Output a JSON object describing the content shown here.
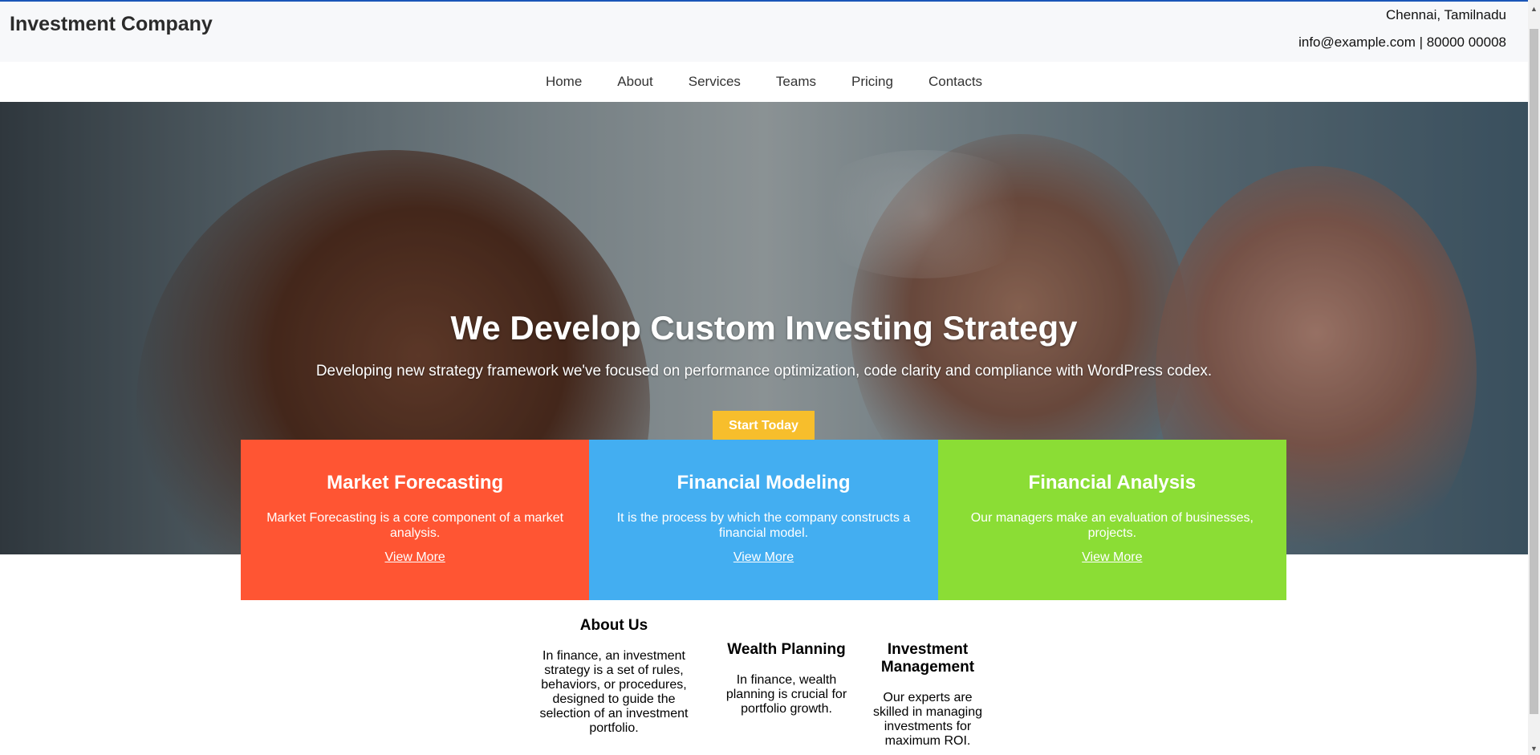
{
  "header": {
    "brand": "Investment Company",
    "location": "Chennai, Tamilnadu",
    "contact": "info@example.com | 80000 00008"
  },
  "nav": {
    "items": [
      "Home",
      "About",
      "Services",
      "Teams",
      "Pricing",
      "Contacts"
    ]
  },
  "hero": {
    "title": "We Develop Custom Investing Strategy",
    "subtitle": "Developing new strategy framework we've focused on performance optimization, code clarity and compliance with WordPress codex.",
    "cta_label": "Start Today"
  },
  "cards": [
    {
      "title": "Market Forecasting",
      "text": "Market Forecasting is a core component of a market analysis.",
      "link": "View More",
      "color": "#ff5533"
    },
    {
      "title": "Financial Modeling",
      "text": "It is the process by which the company constructs a financial model.",
      "link": "View More",
      "color": "#43aef1"
    },
    {
      "title": "Financial Analysis",
      "text": "Our managers make an evaluation of businesses, projects.",
      "link": "View More",
      "color": "#8bdd35"
    }
  ],
  "features": [
    {
      "title": "About Us",
      "text": "In finance, an investment strategy is a set of rules, behaviors, or procedures, designed to guide the selection of an investment portfolio."
    },
    {
      "title": "Wealth Planning",
      "text": "In finance, wealth planning is crucial for portfolio growth."
    },
    {
      "title": "Investment Management",
      "text": "Our experts are skilled in managing investments for maximum ROI."
    }
  ],
  "colors": {
    "cta": "#f7be2c",
    "accent_line": "#1a56b8"
  }
}
